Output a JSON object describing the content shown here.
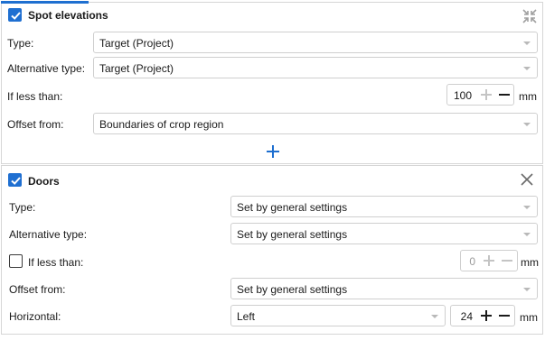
{
  "spot_elevations": {
    "title": "Spot elevations",
    "checked": true,
    "collapse_icon": "collapse-arrows-icon",
    "rows": {
      "type": {
        "label": "Type:",
        "value": "Target (Project)"
      },
      "alt_type": {
        "label": "Alternative type:",
        "value": "Target (Project)"
      },
      "if_less": {
        "label": "If less than:",
        "value": "100",
        "unit": "mm"
      },
      "offset": {
        "label": "Offset from:",
        "value": "Boundaries of crop region"
      }
    },
    "add_icon": "plus-icon"
  },
  "doors": {
    "title": "Doors",
    "checked": true,
    "close_icon": "close-icon",
    "rows": {
      "type": {
        "label": "Type:",
        "value": "Set by general settings"
      },
      "alt_type": {
        "label": "Alternative type:",
        "value": "Set by general settings"
      },
      "if_less": {
        "label": "If less than:",
        "checked": false,
        "value": "0",
        "unit": "mm"
      },
      "offset": {
        "label": "Offset from:",
        "value": "Set by general settings"
      },
      "horizontal": {
        "label": "Horizontal:",
        "value": "Left",
        "amount": "24",
        "unit": "mm"
      }
    }
  },
  "colors": {
    "accent": "#1e6fd0",
    "border": "#d6d6d6"
  }
}
